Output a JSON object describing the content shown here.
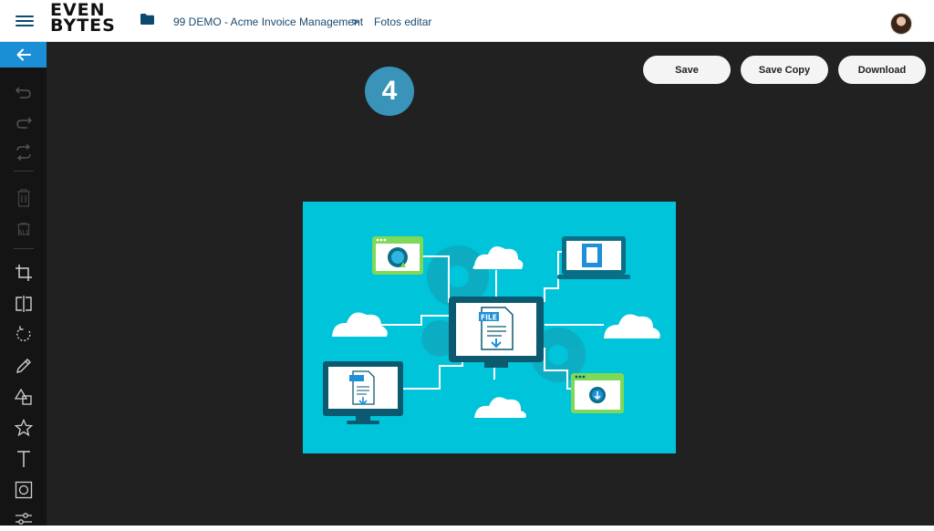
{
  "header": {
    "logo_line1": "EVEN",
    "logo_line2": "BYTES",
    "breadcrumb": {
      "project": "99 DEMO - Acme Invoice Management",
      "separator": ">",
      "current": "Fotos editar"
    }
  },
  "toolbar": {
    "save_label": "Save",
    "save_copy_label": "Save Copy",
    "download_label": "Download"
  },
  "step": {
    "number": "4"
  },
  "sidebar": {
    "icons": [
      "arrow-left-icon",
      "undo-icon",
      "redo-icon",
      "reset-icon",
      "delete-icon",
      "delete-all-icon",
      "crop-icon",
      "flip-icon",
      "rotate-icon",
      "draw-icon",
      "shape-icon",
      "star-icon",
      "text-icon",
      "mask-icon",
      "filter-icon"
    ],
    "delete_all_text": "ALL"
  },
  "image": {
    "file_label": "FILE",
    "colors": {
      "background": "#00c4d9",
      "dark_teal": "#0a6f86",
      "frame": "#0b5a70",
      "green": "#7ed957"
    }
  }
}
